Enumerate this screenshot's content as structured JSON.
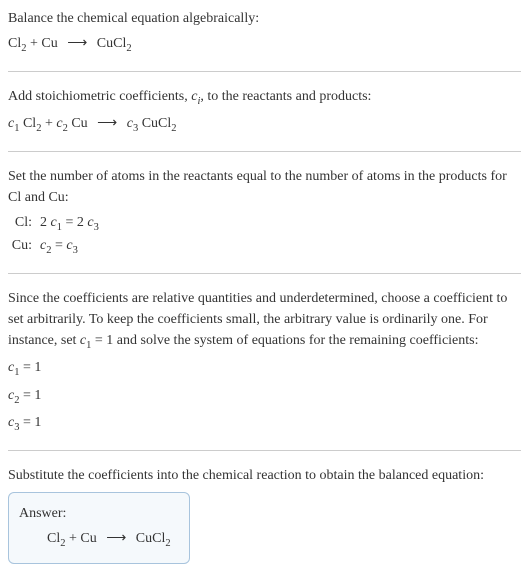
{
  "intro": {
    "text": "Balance the chemical equation algebraically:",
    "equation_prefix": "Cl",
    "sub1": "2",
    "plus": " + Cu ",
    "arrow": "⟶",
    "product": " CuCl",
    "sub2": "2"
  },
  "step1": {
    "text_before": "Add stoichiometric coefficients, ",
    "ci": "c",
    "ci_sub": "i",
    "text_after": ", to the reactants and products:",
    "eq": {
      "c1": "c",
      "c1sub": "1",
      "sp1": " Cl",
      "clsub": "2",
      "plus": " + ",
      "c2": "c",
      "c2sub": "2",
      "sp2": " Cu ",
      "arrow": "⟶",
      "sp3": " ",
      "c3": "c",
      "c3sub": "3",
      "sp4": " CuCl",
      "cuclsub": "2"
    }
  },
  "step2": {
    "text": "Set the number of atoms in the reactants equal to the number of atoms in the products for Cl and Cu:",
    "rows": [
      {
        "label": "Cl:",
        "lhs_coef": "2 ",
        "lhs_var": "c",
        "lhs_sub": "1",
        "eq": " = 2 ",
        "rhs_var": "c",
        "rhs_sub": "3"
      },
      {
        "label": "Cu:",
        "lhs_coef": "",
        "lhs_var": "c",
        "lhs_sub": "2",
        "eq": " = ",
        "rhs_var": "c",
        "rhs_sub": "3"
      }
    ]
  },
  "step3": {
    "text_before": "Since the coefficients are relative quantities and underdetermined, choose a coefficient to set arbitrarily. To keep the coefficients small, the arbitrary value is ordinarily one. For instance, set ",
    "cvar": "c",
    "csub": "1",
    "text_mid": " = 1 and solve the system of equations for the remaining coefficients:",
    "solutions": [
      {
        "var": "c",
        "sub": "1",
        "val": " = 1"
      },
      {
        "var": "c",
        "sub": "2",
        "val": " = 1"
      },
      {
        "var": "c",
        "sub": "3",
        "val": " = 1"
      }
    ]
  },
  "step4": {
    "text": "Substitute the coefficients into the chemical reaction to obtain the balanced equation:"
  },
  "answer": {
    "label": "Answer:",
    "eq_prefix": "Cl",
    "sub1": "2",
    "plus": " + Cu ",
    "arrow": "⟶",
    "product": " CuCl",
    "sub2": "2"
  }
}
